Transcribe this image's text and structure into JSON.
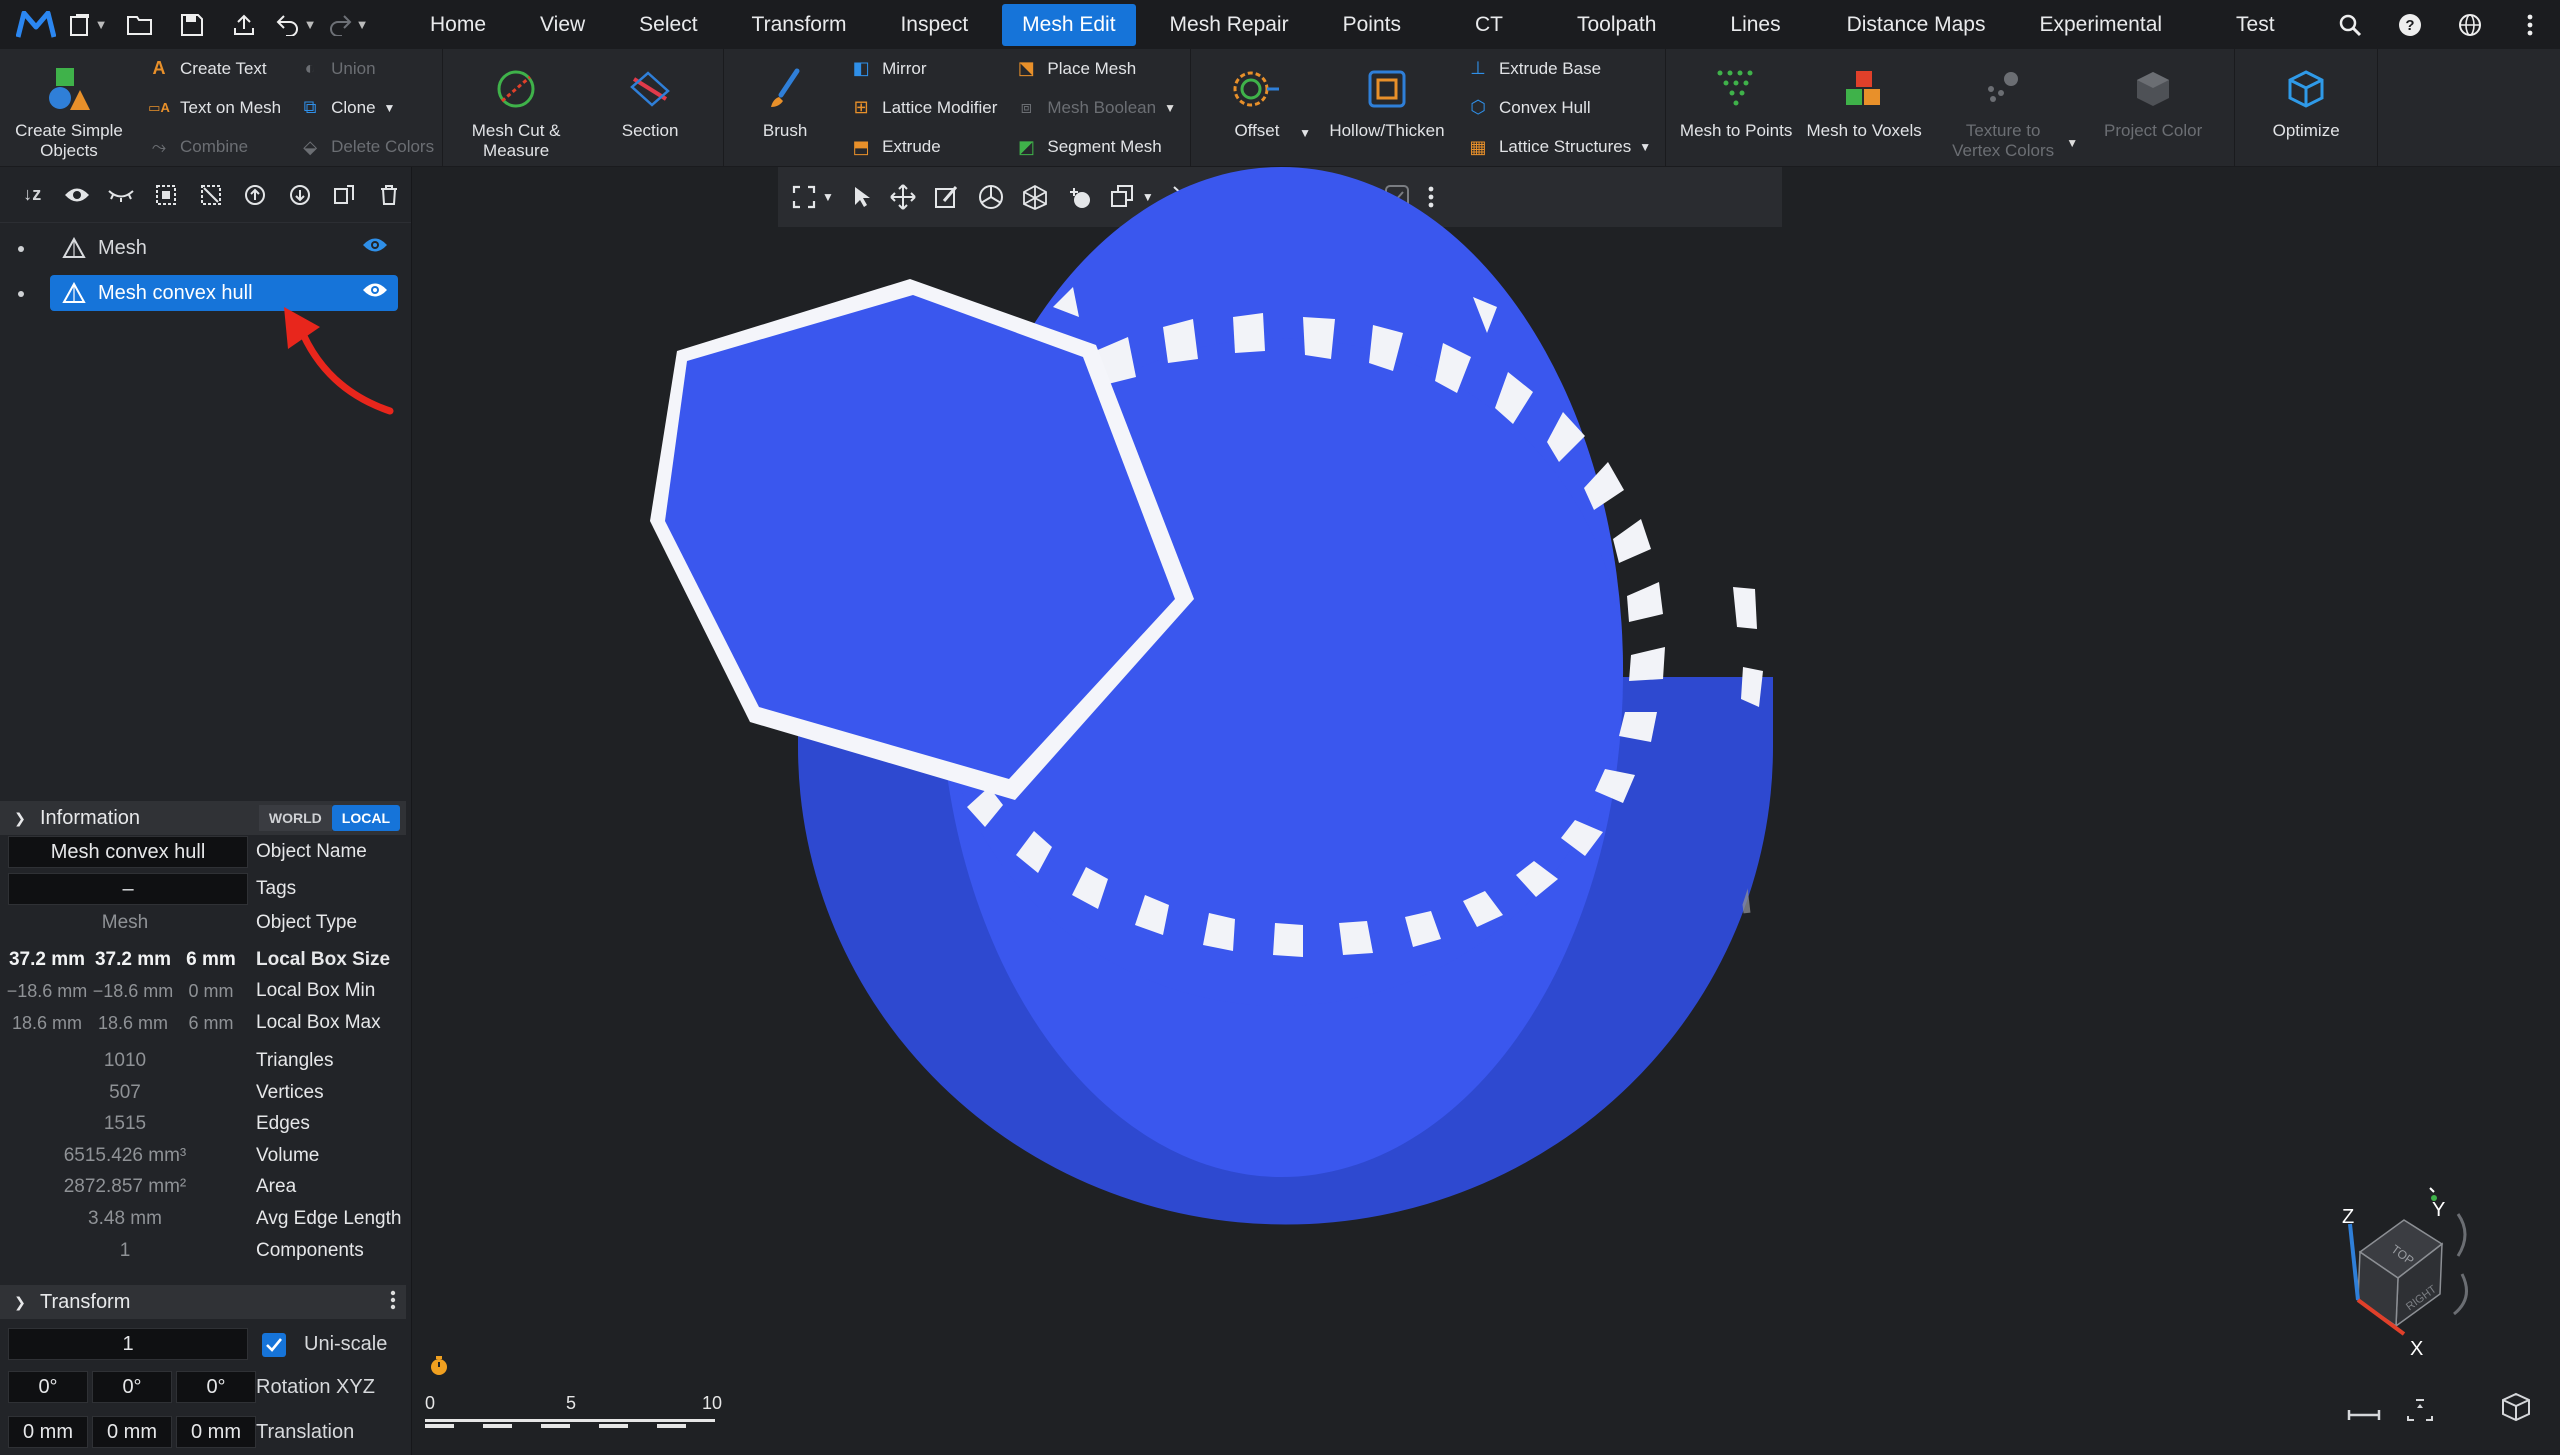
{
  "menubar": {
    "tabs": [
      "Home",
      "View",
      "Select",
      "Transform",
      "Inspect",
      "Mesh Edit",
      "Mesh Repair",
      "Points",
      "CT",
      "Toolpath",
      "Lines",
      "Distance Maps",
      "Experimental",
      "Test"
    ],
    "active_tab": "Mesh Edit"
  },
  "ribbon": {
    "create_simple_objects": "Create Simple Objects",
    "create_text": "Create Text",
    "text_on_mesh": "Text on Mesh",
    "combine": "Combine",
    "union": "Union",
    "clone": "Clone",
    "delete_colors": "Delete Colors",
    "mesh_cut_measure": "Mesh Cut & Measure",
    "section": "Section",
    "brush": "Brush",
    "mirror": "Mirror",
    "lattice_modifier": "Lattice Modifier",
    "extrude": "Extrude",
    "place_mesh": "Place Mesh",
    "mesh_boolean": "Mesh Boolean",
    "segment_mesh": "Segment Mesh",
    "offset": "Offset",
    "hollow_thicken": "Hollow/Thicken",
    "extrude_base": "Extrude Base",
    "convex_hull": "Convex Hull",
    "lattice_structures": "Lattice Structures",
    "mesh_to_points": "Mesh to Points",
    "mesh_to_voxels": "Mesh to Voxels",
    "texture_to_vertex_colors": "Texture to Vertex Colors",
    "project_color": "Project Color",
    "optimize": "Optimize"
  },
  "scene": {
    "items": [
      {
        "label": "Mesh",
        "selected": false
      },
      {
        "label": "Mesh convex hull",
        "selected": true
      }
    ]
  },
  "information": {
    "title": "Information",
    "world": "WORLD",
    "local": "LOCAL",
    "object_name": "Mesh convex hull",
    "object_name_label": "Object Name",
    "tags": "–",
    "tags_label": "Tags",
    "object_type": "Mesh",
    "object_type_label": "Object Type",
    "box_size": [
      "37.2 mm",
      "37.2 mm",
      "6 mm"
    ],
    "box_size_label": "Local Box Size",
    "box_min": [
      "−18.6 mm",
      "−18.6 mm",
      "0 mm"
    ],
    "box_min_label": "Local Box Min",
    "box_max": [
      "18.6 mm",
      "18.6 mm",
      "6 mm"
    ],
    "box_max_label": "Local Box Max",
    "triangles": "1010",
    "triangles_label": "Triangles",
    "vertices": "507",
    "vertices_label": "Vertices",
    "edges": "1515",
    "edges_label": "Edges",
    "volume": "6515.426 mm³",
    "volume_label": "Volume",
    "area": "2872.857 mm²",
    "area_label": "Area",
    "avg_edge": "3.48 mm",
    "avg_edge_label": "Avg Edge Length",
    "components": "1",
    "components_label": "Components"
  },
  "transform": {
    "title": "Transform",
    "scale": "1",
    "uniscale_label": "Uni-scale",
    "uniscale_checked": true,
    "rotation": [
      "0°",
      "0°",
      "0°"
    ],
    "rotation_label": "Rotation XYZ",
    "translation": [
      "0 mm",
      "0 mm",
      "0 mm"
    ],
    "translation_label": "Translation"
  },
  "viewport": {
    "scale_labels": [
      "0",
      "5",
      "10"
    ],
    "axis_labels": {
      "x": "X",
      "y": "Y",
      "z": "Z"
    },
    "cube_labels": {
      "top": "TOP",
      "right": "RIGHT"
    }
  },
  "colors": {
    "accent": "#1674d9",
    "mesh_blue": "#3355ee",
    "panel_bg": "#222428"
  }
}
